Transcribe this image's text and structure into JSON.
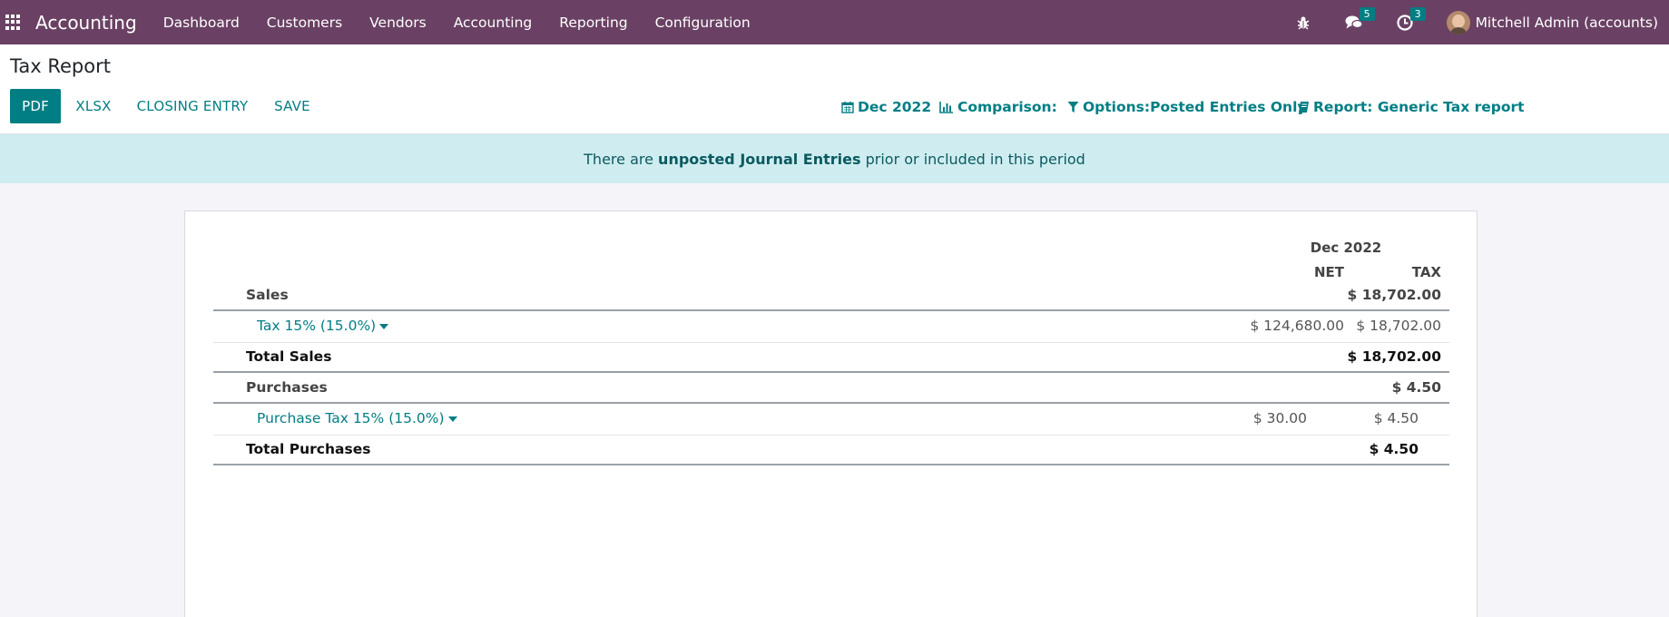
{
  "navbar": {
    "app_name": "Accounting",
    "menu": [
      "Dashboard",
      "Customers",
      "Vendors",
      "Accounting",
      "Reporting",
      "Configuration"
    ],
    "messages_count": "5",
    "activities_count": "3",
    "user_name": "Mitchell Admin (accounts)"
  },
  "control_panel": {
    "title": "Tax Report",
    "buttons": {
      "pdf": "PDF",
      "xlsx": "XLSX",
      "closing_entry": "CLOSING ENTRY",
      "save": "SAVE"
    },
    "filters": {
      "date": "Dec 2022",
      "comparison": "Comparison:",
      "options": "Options:Posted Entries Only",
      "report": "Report: Generic Tax report"
    }
  },
  "alert": {
    "prefix": "There are ",
    "link": "unposted Journal Entries",
    "suffix": " prior or included in this period"
  },
  "report": {
    "period": "Dec 2022",
    "columns": {
      "net": "NET",
      "tax": "TAX"
    },
    "rows": [
      {
        "type": "section",
        "label": "Sales",
        "net": "",
        "tax": "$ 18,702.00"
      },
      {
        "type": "line",
        "label": "Tax 15% (15.0%)",
        "net": "$ 124,680.00",
        "tax": "$ 18,702.00"
      },
      {
        "type": "total",
        "label": "Total Sales",
        "net": "",
        "tax": "$ 18,702.00"
      },
      {
        "type": "section",
        "label": "Purchases",
        "net": "",
        "tax": "$ 4.50"
      },
      {
        "type": "line",
        "label": "Purchase Tax 15% (15.0%)",
        "net": "$ 30.00",
        "tax": "$ 4.50"
      },
      {
        "type": "total",
        "label": "Total Purchases",
        "net": "",
        "tax": "$ 4.50"
      }
    ]
  },
  "colors": {
    "navbar": "#6a4164",
    "primary": "#017e84",
    "alert_bg": "#cfedf0"
  }
}
